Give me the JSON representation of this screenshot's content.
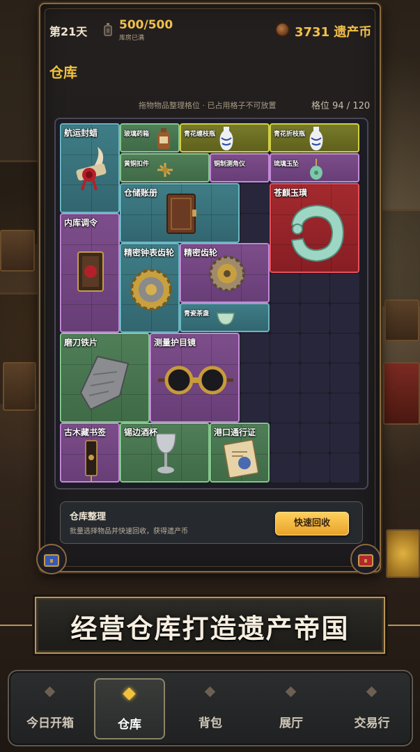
{
  "header": {
    "day": "第21天",
    "capacity_value": "500/500",
    "capacity_status": "库房已满",
    "coins": "3731 遗产币"
  },
  "warehouse": {
    "title": "仓库",
    "hint": "拖物物品整理格位 · 已占用格子不可放置",
    "slots": "格位 94 / 120",
    "items": [
      {
        "name": "航运封蜡"
      },
      {
        "name": "玻璃药箱"
      },
      {
        "name": "青花缠枝瓶"
      },
      {
        "name": "青花折枝瓶"
      },
      {
        "name": "黄铜扣件"
      },
      {
        "name": "铜制测角仪"
      },
      {
        "name": "琉璃玉坠"
      },
      {
        "name": "仓储账册"
      },
      {
        "name": "苍麒玉璜"
      },
      {
        "name": "内库调令"
      },
      {
        "name": "精密钟表齿轮"
      },
      {
        "name": "精密齿轮"
      },
      {
        "name": "青瓷茶盏"
      },
      {
        "name": "磨刀铁片"
      },
      {
        "name": "测量护目镜"
      },
      {
        "name": "古木藏书签"
      },
      {
        "name": "锡边酒杯"
      },
      {
        "name": "港口通行证"
      }
    ],
    "colors": {
      "teal": "#3f7d86",
      "green": "#4f7e57",
      "olive": "#787a2a",
      "purple": "#7c4d8a",
      "red": "#a32a2e"
    }
  },
  "recycle": {
    "title": "仓库整理",
    "desc": "批量选择物品并快速回收，获得遗产币",
    "button": "快速回收"
  },
  "slogan": "经营仓库打造遗产帝国",
  "nav": {
    "tabs": [
      {
        "label": "今日开箱",
        "active": false
      },
      {
        "label": "仓库",
        "active": true
      },
      {
        "label": "背包",
        "active": false
      },
      {
        "label": "展厅",
        "active": false
      },
      {
        "label": "交易行",
        "active": false
      }
    ]
  }
}
